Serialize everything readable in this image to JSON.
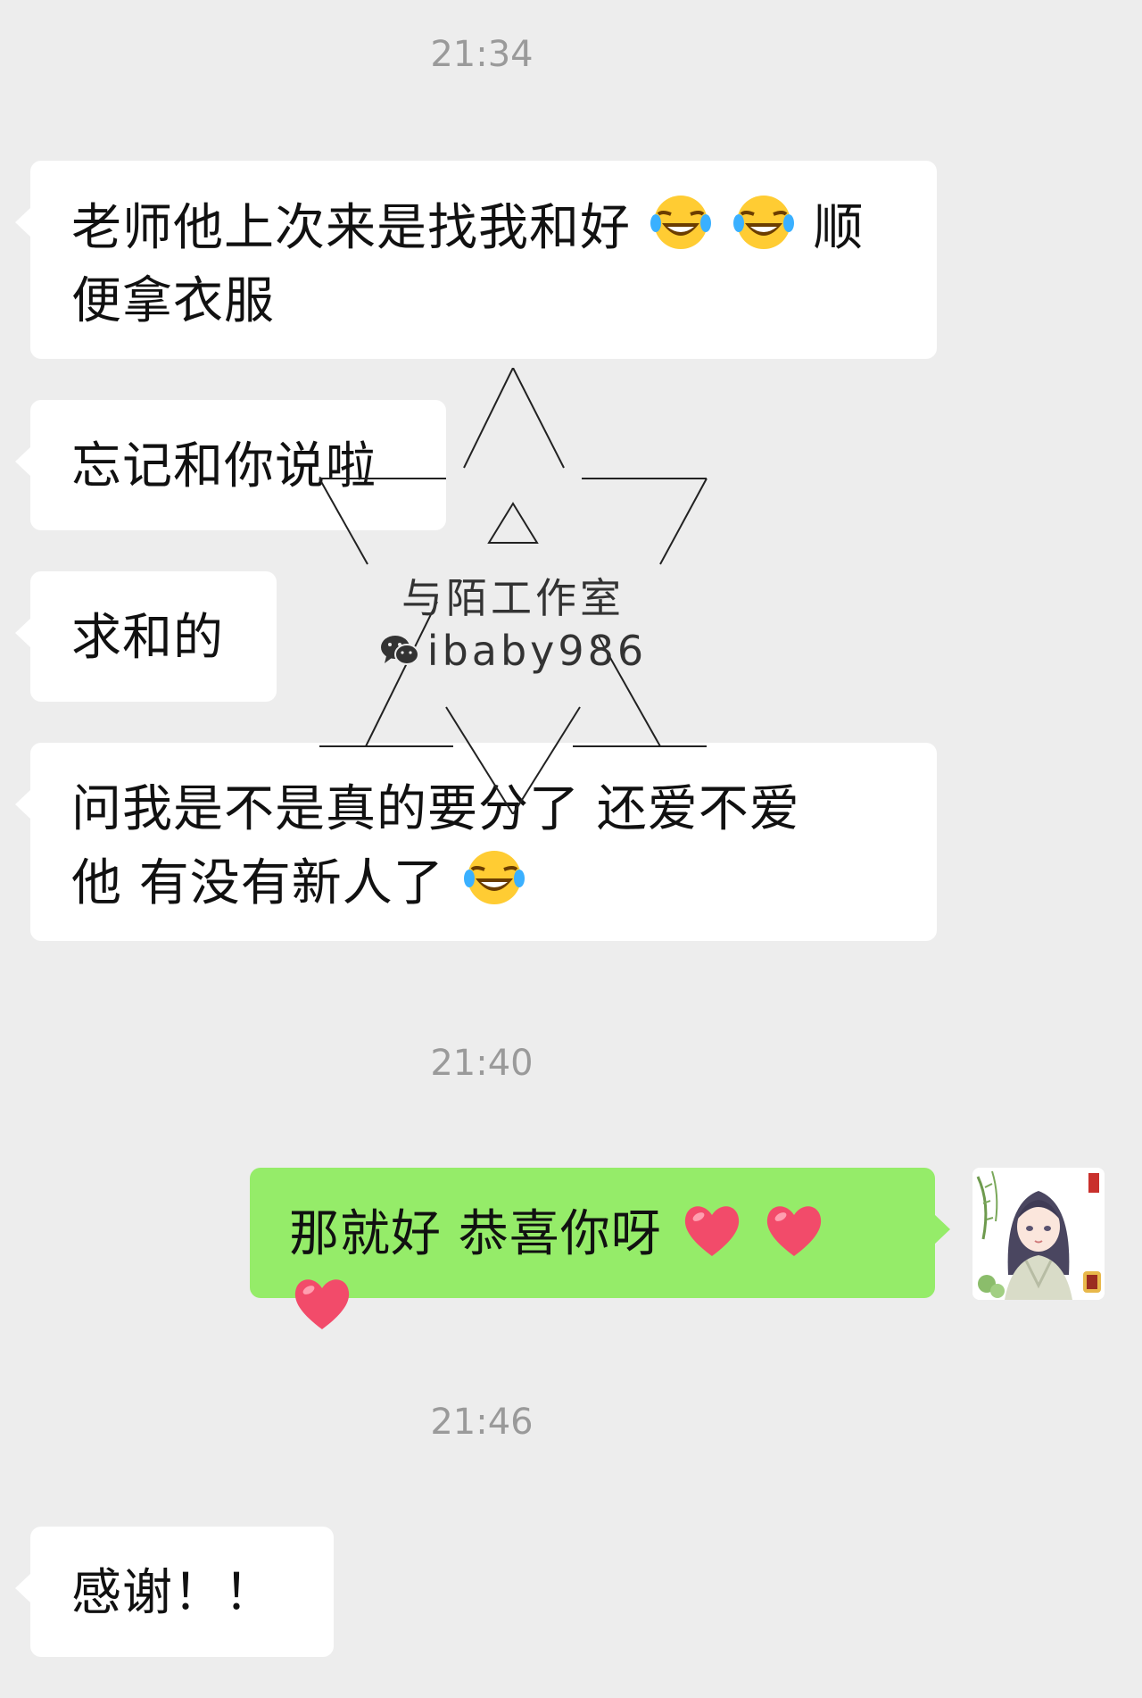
{
  "timestamps": [
    "21:34",
    "21:40",
    "21:46"
  ],
  "messages": {
    "m1": {
      "line1_text": "老师他上次来是找我和好",
      "line1_tail": "顺",
      "line2_text": "便拿衣服",
      "emoji": "laughing-with-tears-icon"
    },
    "m2": {
      "text": "忘记和你说啦"
    },
    "m3": {
      "text": "求和的"
    },
    "m4": {
      "line1_text": "问我是不是真的要分了 还爱不爱",
      "line2_text": "他 有没有新人了",
      "emoji": "laughing-with-tears-icon"
    },
    "m5": {
      "text": "那就好 恭喜你呀",
      "emoji": "red-heart-icon"
    },
    "m6": {
      "text": "感谢！！"
    }
  },
  "watermark": {
    "title": "与陌工作室",
    "wechat_id": "ibaby986",
    "icon": "wechat-icon"
  },
  "colors": {
    "background": "#ededed",
    "incoming_bubble": "#ffffff",
    "outgoing_bubble": "#95ec69",
    "timestamp_text": "#9a9a9a"
  }
}
